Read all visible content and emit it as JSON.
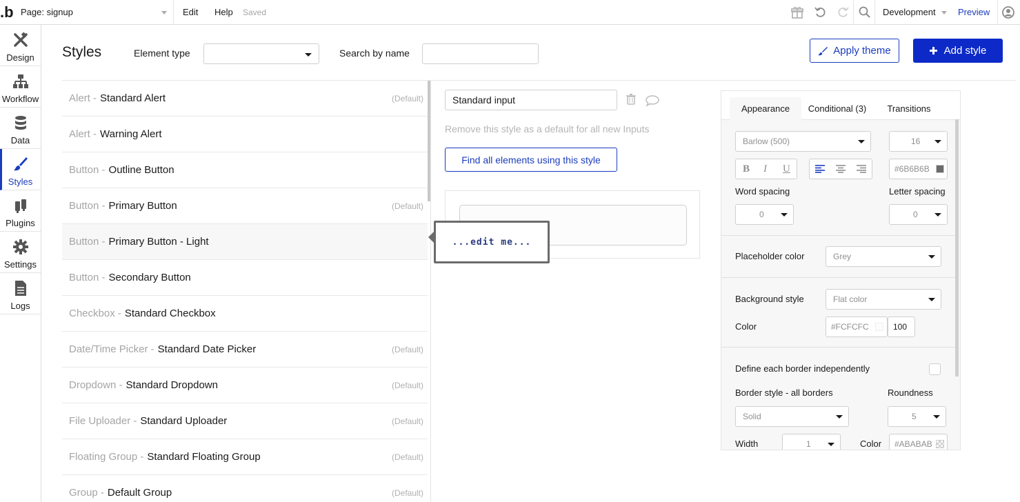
{
  "topbar": {
    "logo": ".b",
    "page_label": "Page: signup",
    "menu": [
      "Edit",
      "Help"
    ],
    "status": "Saved",
    "environment": "Development",
    "preview": "Preview",
    "icons": [
      "gift-icon",
      "undo-icon",
      "redo-icon",
      "search-icon",
      "user-icon"
    ]
  },
  "sidebar": {
    "items": [
      {
        "label": "Design",
        "icon": "design-icon"
      },
      {
        "label": "Workflow",
        "icon": "workflow-icon"
      },
      {
        "label": "Data",
        "icon": "database-icon"
      },
      {
        "label": "Styles",
        "icon": "brush-icon",
        "active": true
      },
      {
        "label": "Plugins",
        "icon": "plugins-icon"
      },
      {
        "label": "Settings",
        "icon": "gear-icon"
      },
      {
        "label": "Logs",
        "icon": "document-icon"
      }
    ]
  },
  "header": {
    "title": "Styles",
    "element_type_label": "Element type",
    "element_type_value": "",
    "search_label": "Search by name",
    "search_value": "",
    "apply_theme": "Apply theme",
    "add_style": "Add style"
  },
  "styles_list": [
    {
      "category": "Alert - ",
      "name": "Standard Alert",
      "default": "(Default)"
    },
    {
      "category": "Alert - ",
      "name": "Warning Alert",
      "default": ""
    },
    {
      "category": "Button - ",
      "name": "Outline Button",
      "default": ""
    },
    {
      "category": "Button - ",
      "name": "Primary Button",
      "default": "(Default)"
    },
    {
      "category": "Button - ",
      "name": "Primary Button - Light",
      "default": ""
    },
    {
      "category": "Button - ",
      "name": "Secondary Button",
      "default": ""
    },
    {
      "category": "Checkbox - ",
      "name": "Standard Checkbox",
      "default": ""
    },
    {
      "category": "Date/Time Picker - ",
      "name": "Standard Date Picker",
      "default": "(Default)"
    },
    {
      "category": "Dropdown - ",
      "name": "Standard Dropdown",
      "default": "(Default)"
    },
    {
      "category": "File Uploader - ",
      "name": "Standard Uploader",
      "default": "(Default)"
    },
    {
      "category": "Floating Group - ",
      "name": "Standard Floating Group",
      "default": "(Default)"
    },
    {
      "category": "Group - ",
      "name": "Default Group",
      "default": "(Default)"
    }
  ],
  "editor": {
    "style_name": "Standard input",
    "remove_default": "Remove this style as a default for all new Inputs",
    "find_elements": "Find all elements using this style",
    "preview_hint": "...edit me..."
  },
  "panel": {
    "tabs": [
      "Appearance",
      "Conditional (3)",
      "Transitions"
    ],
    "font": "Barlow (500)",
    "font_size": "16",
    "font_color": "#6B6B6B",
    "font_color_hex": "#6b6b6b",
    "format_buttons": [
      "B",
      "I",
      "U"
    ],
    "word_spacing_label": "Word spacing",
    "word_spacing": "0",
    "letter_spacing_label": "Letter spacing",
    "letter_spacing": "0",
    "placeholder_color_label": "Placeholder color",
    "placeholder_color": "Grey",
    "background_style_label": "Background style",
    "background_style": "Flat color",
    "color_label": "Color",
    "bg_color": "#FCFCFC",
    "bg_opacity": "100",
    "border_independent_label": "Define each border independently",
    "border_style_label": "Border style - all borders",
    "border_style": "Solid",
    "roundness_label": "Roundness",
    "roundness": "5",
    "width_label": "Width",
    "width": "1",
    "border_color_label": "Color",
    "border_color": "#ABABAB"
  },
  "colors": {
    "accent": "#1a3cbd",
    "add_button": "#0d2ac8"
  }
}
